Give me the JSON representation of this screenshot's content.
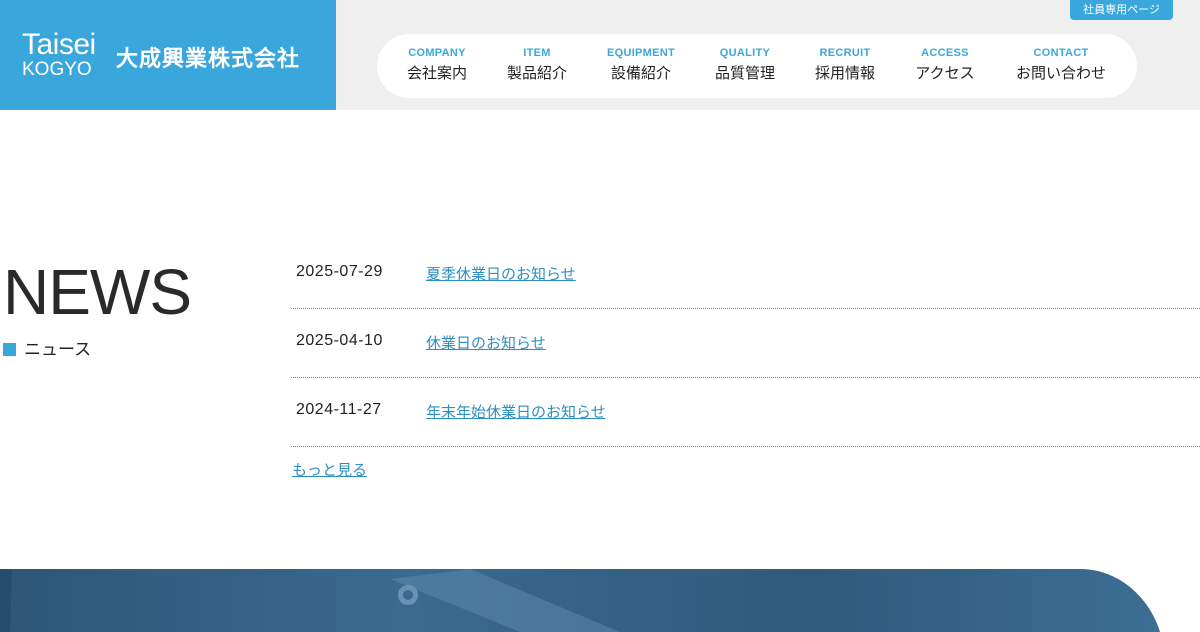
{
  "header": {
    "logo": {
      "en_line1": "Taisei",
      "en_line2": "KOGYO",
      "jp": "大成興業株式会社"
    },
    "employee_link": "社員専用ページ",
    "nav": [
      {
        "en": "COMPANY",
        "jp": "会社案内"
      },
      {
        "en": "ITEM",
        "jp": "製品紹介"
      },
      {
        "en": "EQUIPMENT",
        "jp": "設備紹介"
      },
      {
        "en": "QUALITY",
        "jp": "品質管理"
      },
      {
        "en": "RECRUIT",
        "jp": "採用情報"
      },
      {
        "en": "ACCESS",
        "jp": "アクセス"
      },
      {
        "en": "CONTACT",
        "jp": "お問い合わせ"
      }
    ]
  },
  "news": {
    "heading": "NEWS",
    "subheading": "ニュース",
    "items": [
      {
        "date": "2025-07-29",
        "title": "夏季休業日のお知らせ"
      },
      {
        "date": "2025-04-10",
        "title": "休業日のお知らせ"
      },
      {
        "date": "2024-11-27",
        "title": "年末年始休業日のお知らせ"
      }
    ],
    "more": "もっと見る"
  },
  "colors": {
    "brand_blue": "#3aa7dc",
    "link_blue": "#2c8fc3",
    "header_bg": "#efefef"
  }
}
